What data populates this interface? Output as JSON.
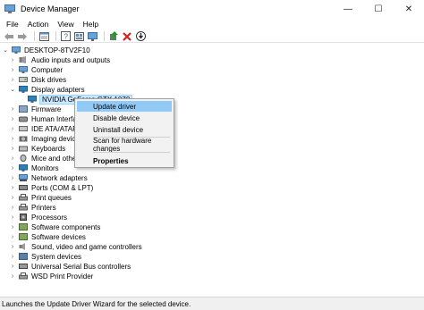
{
  "window": {
    "title": "Device Manager",
    "minimize_glyph": "—",
    "maximize_glyph": "☐",
    "close_glyph": "✕"
  },
  "menu": [
    "File",
    "Action",
    "View",
    "Help"
  ],
  "toolbar": [
    "back-icon",
    "forward-icon",
    "properties-icon",
    "help-icon",
    "show-hidden-icon",
    "monitor-icon",
    "update-driver-icon",
    "uninstall-icon",
    "scan-hardware-icon"
  ],
  "tree": {
    "root": "DESKTOP-8TV2F10",
    "items": [
      "Audio inputs and outputs",
      "Computer",
      "Disk drives",
      "Display adapters",
      "NVIDIA GeForce GTX 1070",
      "Firmware",
      "Human Interface Devices",
      "IDE ATA/ATAPI controllers",
      "Imaging devices",
      "Keyboards",
      "Mice and other pointing devices",
      "Monitors",
      "Network adapters",
      "Ports (COM & LPT)",
      "Print queues",
      "Printers",
      "Processors",
      "Software components",
      "Software devices",
      "Sound, video and game controllers",
      "System devices",
      "Universal Serial Bus controllers",
      "WSD Print Provider"
    ]
  },
  "context_menu": {
    "items": [
      "Update driver",
      "Disable device",
      "Uninstall device",
      "Scan for hardware changes",
      "Properties"
    ]
  },
  "status": "Launches the Update Driver Wizard for the selected device.",
  "colors": {
    "highlight": "#91c9f7",
    "selection": "#cce8ff",
    "status_bg": "#f0f0f0"
  }
}
